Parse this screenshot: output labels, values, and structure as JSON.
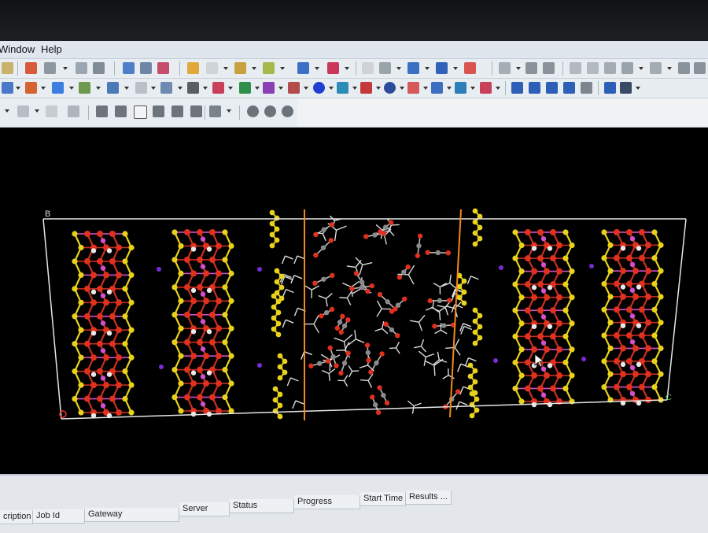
{
  "menu": {
    "window": "Window",
    "help": "Help"
  },
  "toolbar": {
    "icons": [
      "move-icon",
      "home-icon",
      "target-icon",
      "fit-icon",
      "camera-icon",
      "atom-select-icon",
      "abc-label-icon",
      "lattice-icon",
      "pencil-icon",
      "element-c-icon",
      "bond-tool-icon",
      "ring-tool-icon",
      "cross-icon",
      "dots-icon",
      "grid-icon",
      "hydrogen-icon",
      "layers-icon",
      "bars-icon",
      "measure-icon",
      "column-icon",
      "sort-asc-icon",
      "sort-desc-icon"
    ]
  },
  "viewport": {
    "axis_b": "B",
    "axis_c": "C"
  },
  "jobs_table": {
    "columns": [
      "cription",
      "Job Id",
      "Gateway",
      "Server",
      "Status",
      "Progress",
      "Start Time",
      "Results ..."
    ]
  }
}
